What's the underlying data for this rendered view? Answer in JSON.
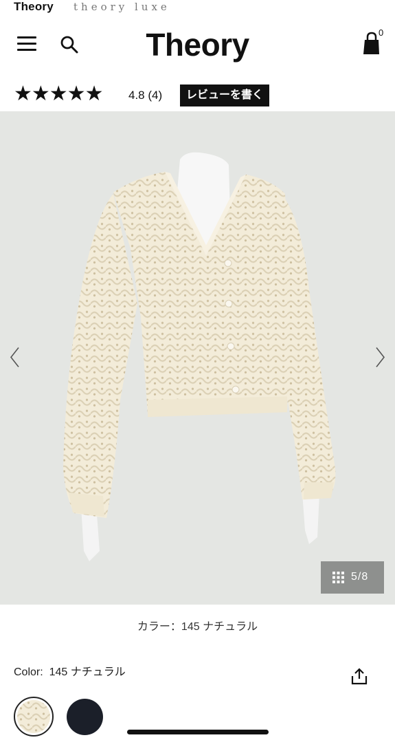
{
  "brands": {
    "primary": "Theory",
    "secondary": "theory luxe"
  },
  "header": {
    "logo": "Theory",
    "menu_icon": "hamburger-menu-icon",
    "search_icon": "search-icon",
    "bag_icon": "shopping-bag-icon",
    "bag_count": "0"
  },
  "rating": {
    "stars": "★★★★★",
    "star_value": 4.8,
    "text": "4.8 (4)",
    "review_button": "レビューを書く"
  },
  "gallery": {
    "image_description_icon": "product-photo",
    "prev_icon": "chevron-left-icon",
    "next_icon": "chevron-right-icon",
    "counter": "5/8",
    "counter_icon": "grid-icon",
    "background": "#e4e6e3"
  },
  "color_caption": "カラー：145 ナチュラル",
  "color_selector": {
    "label": "Color:",
    "value": "145 ナチュラル",
    "share_icon": "share-icon",
    "swatches": [
      {
        "name": "145 ナチュラル",
        "hex": "#f3ecd9",
        "selected": true
      },
      {
        "name": "navy",
        "hex": "#1b1f29",
        "selected": false
      }
    ]
  }
}
